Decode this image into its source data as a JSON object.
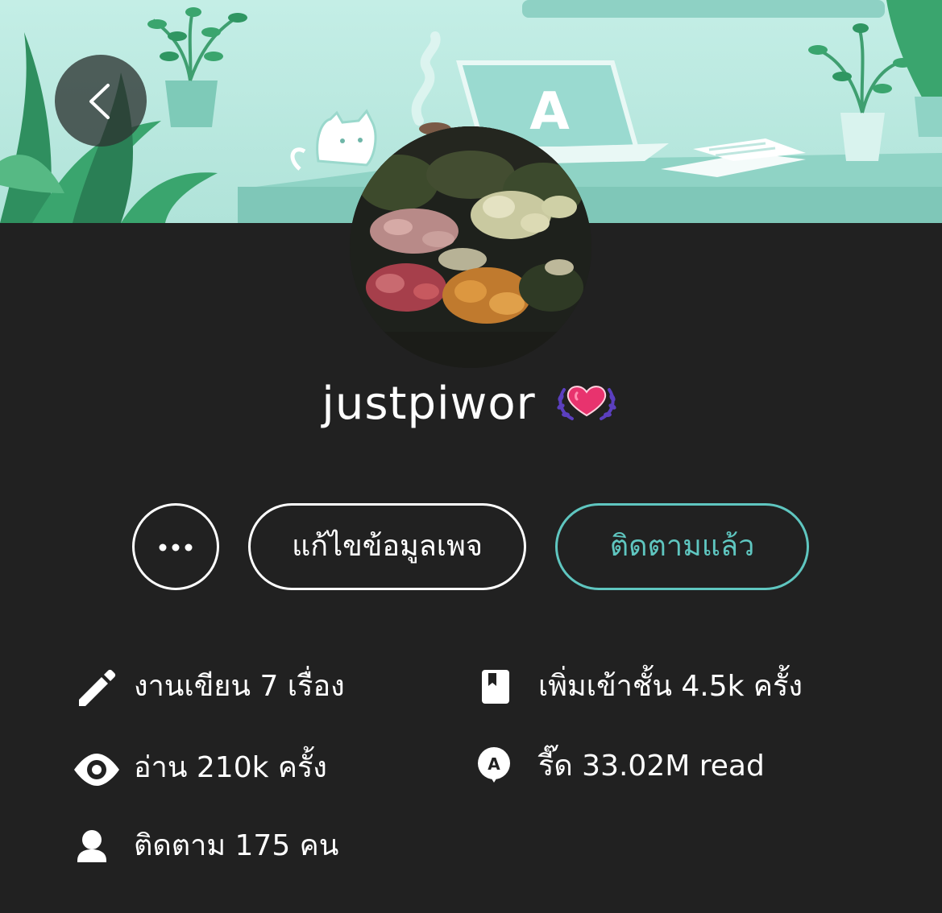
{
  "header": {
    "back_icon": "chevron-left-icon",
    "banner_laptop_letter": "A"
  },
  "profile": {
    "username": "justpiwor",
    "badge_icon": "heart-laurel-badge-icon"
  },
  "actions": {
    "more_icon": "ellipsis-icon",
    "edit_label": "แก้ไขข้อมูลเพจ",
    "follow_label": "ติดตามแล้ว"
  },
  "stats": {
    "works": {
      "icon": "pencil-icon",
      "label": "งานเขียน 7 เรื่อง"
    },
    "shelf": {
      "icon": "bookmark-book-icon",
      "label": "เพิ่มเข้าชั้น 4.5k ครั้ง"
    },
    "reads": {
      "icon": "eye-icon",
      "label": "อ่าน 210k ครั้ง"
    },
    "coins": {
      "icon": "readawrite-coin-icon",
      "coin_letter": "A",
      "label": "รี๊ด 33.02M read"
    },
    "followers": {
      "icon": "user-icon",
      "label": "ติดตาม 175 คน"
    }
  },
  "colors": {
    "background": "#212121",
    "accent": "#5fc6c0",
    "text": "#ffffff",
    "banner": "#b6e6de",
    "badge_heart": "#e8336e",
    "badge_laurel": "#5b3fbf"
  }
}
